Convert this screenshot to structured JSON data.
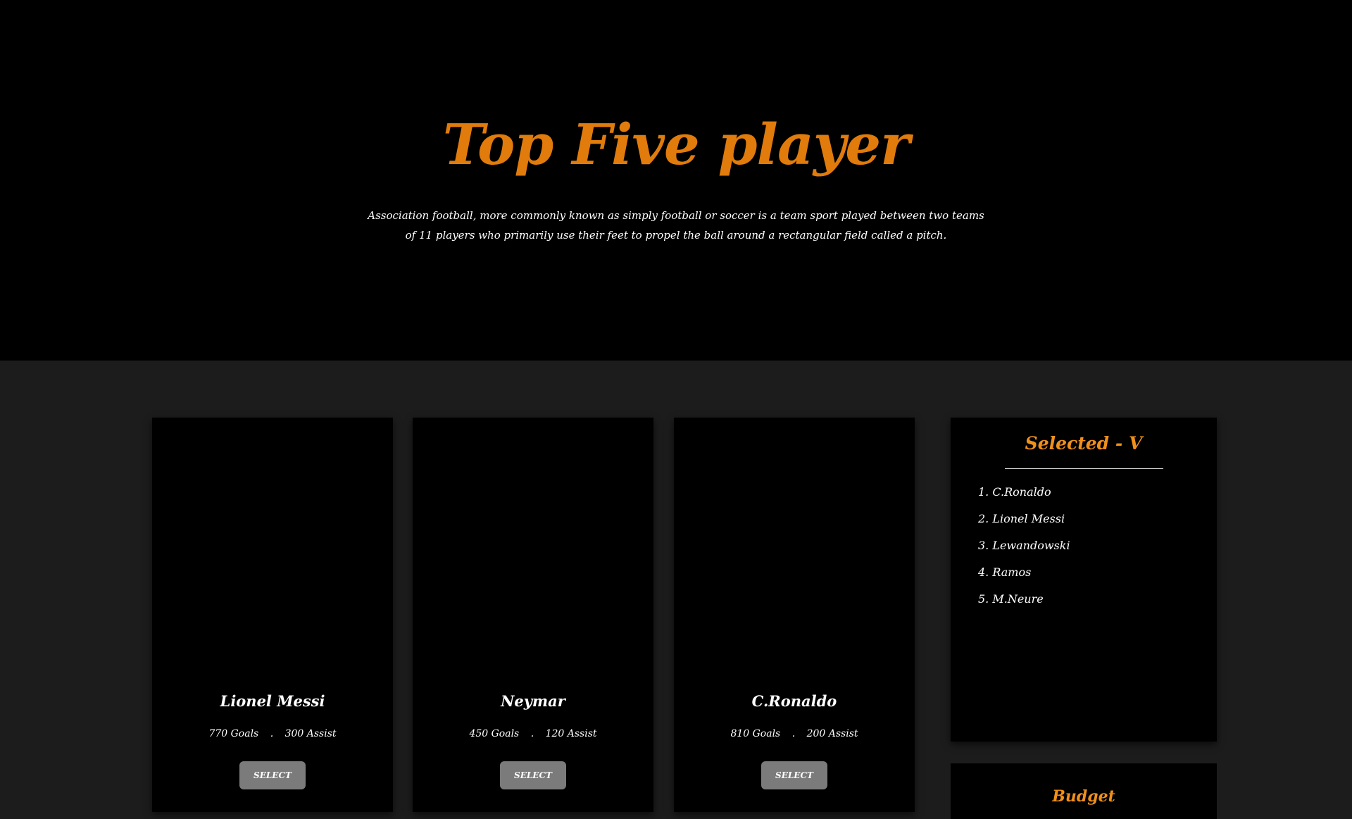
{
  "hero": {
    "title": "Top Five player",
    "description": "Association football, more commonly known as simply football or soccer is a team sport played between two teams of 11 players who primarily use their feet to propel the ball around a rectangular field called a pitch."
  },
  "cards": [
    {
      "name": "Lionel Messi",
      "goals": "770 Goals",
      "assist": "300 Assist",
      "button": "SELECT",
      "jersey": "barcelona"
    },
    {
      "name": "Neymar",
      "goals": "450 Goals",
      "assist": "120 Assist",
      "button": "SELECT",
      "jersey": "psg"
    },
    {
      "name": "C.Ronaldo",
      "goals": "810 Goals",
      "assist": "200 Assist",
      "button": "SELECT",
      "jersey": "manchester-united"
    }
  ],
  "stat_separator": ".",
  "selected": {
    "title": "Selected - V",
    "items": [
      "1. C.Ronaldo",
      "2. Lionel Messi",
      "3. Lewandowski",
      "4. Ramos",
      "5. M.Neure"
    ]
  },
  "budget": {
    "title": "Budget"
  },
  "colors": {
    "accent": "#e07b0c",
    "panel_accent": "#f0901a",
    "card_bg": "#000000",
    "page_bg": "#1c1c1c",
    "button_bg": "#7b7b7b"
  }
}
